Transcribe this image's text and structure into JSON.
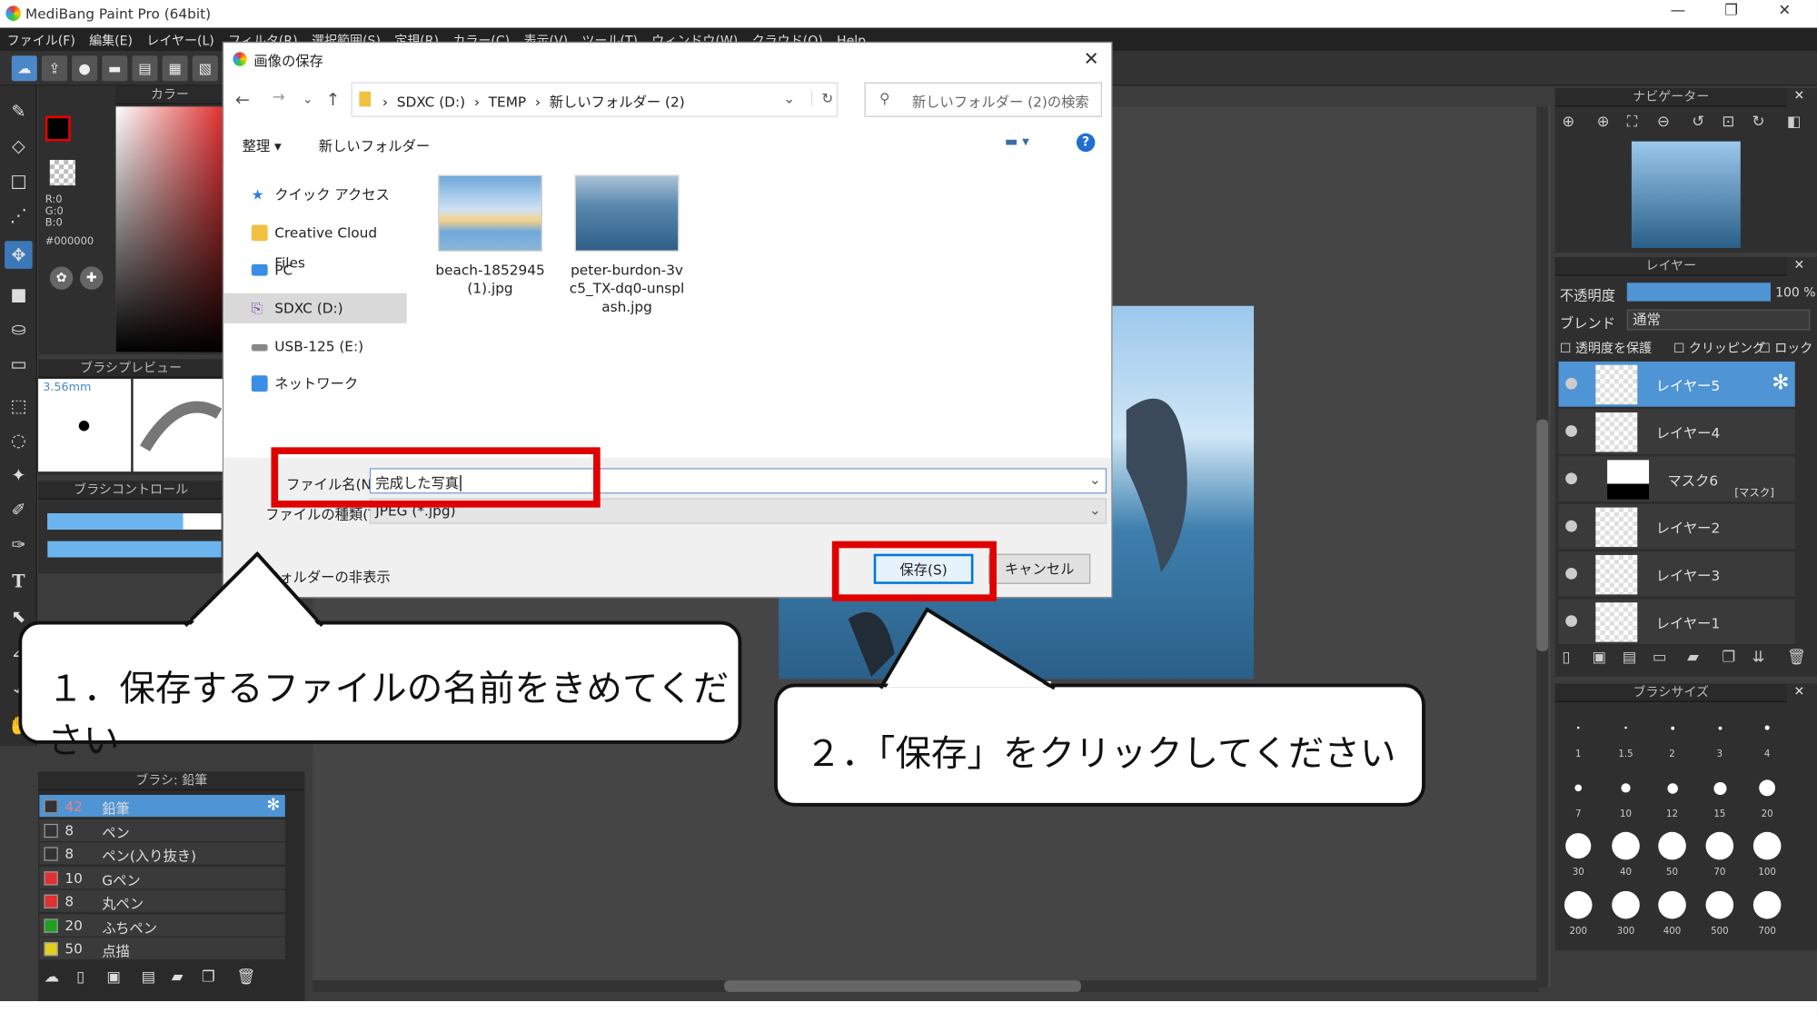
{
  "window": {
    "title": "MediBang Paint Pro (64bit)",
    "controls": [
      "—",
      "❐",
      "✕"
    ]
  },
  "menu": [
    "ファイル(F)",
    "編集(E)",
    "レイヤー(L)",
    "フィルタ(R)",
    "選択範囲(S)",
    "定規(R)",
    "カラー(C)",
    "表示(V)",
    "ツール(T)",
    "ウィンドウ(W)",
    "クラウド(O)",
    "Help"
  ],
  "panels": {
    "color": "カラー",
    "rgb": [
      "R:0",
      "G:0",
      "B:0"
    ],
    "hex": "#000000",
    "brush_preview": "ブラシプレビュー",
    "brush_size": "3.56mm",
    "brush_control": "ブラシコントロール",
    "brush_list_title": "ブラシ: 鉛筆",
    "navigator": "ナビゲーター",
    "layer": "レイヤー",
    "opacity_label": "不透明度",
    "opacity_value": "100 %",
    "blend_label": "ブレンド",
    "blend_value": "通常",
    "protect_alpha": "透明度を保護",
    "clipping": "クリッピング",
    "lock": "ロック",
    "brush_size_panel": "ブラシサイズ"
  },
  "layers": [
    {
      "name": "レイヤー5",
      "selected": true
    },
    {
      "name": "レイヤー4",
      "selected": false
    },
    {
      "name": "マスク6",
      "tag": "[マスク]",
      "selected": false
    },
    {
      "name": "レイヤー2",
      "selected": false
    },
    {
      "name": "レイヤー3",
      "selected": false
    },
    {
      "name": "レイヤー1",
      "selected": false
    }
  ],
  "brushes": [
    {
      "size": "42",
      "name": "鉛筆",
      "color": "#333333",
      "selected": true
    },
    {
      "size": "8",
      "name": "ペン",
      "color": "#333333"
    },
    {
      "size": "8",
      "name": "ペン(入り抜き)",
      "color": "#333333"
    },
    {
      "size": "10",
      "name": "Gペン",
      "color": "#e03030"
    },
    {
      "size": "8",
      "name": "丸ペン",
      "color": "#e03030"
    },
    {
      "size": "20",
      "name": "ふちペン",
      "color": "#20a020"
    },
    {
      "size": "50",
      "name": "点描",
      "color": "#e0d020"
    }
  ],
  "brush_sizes": [
    "1",
    "1.5",
    "2",
    "3",
    "4",
    "7",
    "10",
    "12",
    "15",
    "20",
    "30",
    "40",
    "50",
    "70",
    "100",
    "200",
    "300",
    "400",
    "500",
    "700"
  ],
  "dialog": {
    "title": "画像の保存",
    "path": [
      "SDXC (D:)",
      "TEMP",
      "新しいフォルダー (2)"
    ],
    "search_placeholder": "新しいフォルダー (2)の検索",
    "organize": "整理 ▾",
    "new_folder": "新しいフォルダー",
    "help": "?",
    "nav": [
      "クイック アクセス",
      "Creative Cloud Files",
      "PC",
      "SDXC (D:)",
      "USB-125 (E:)",
      "ネットワーク"
    ],
    "files": [
      {
        "name": "beach-1852945\n(1).jpg"
      },
      {
        "name": "peter-burdon-3v\nc5_TX-dq0-unspl\nash.jpg"
      }
    ],
    "filename_label": "ファイル名(N):",
    "filename_value": "完成した写真",
    "filetype_label": "ファイルの種類(T):",
    "filetype_value": "JPEG (*.jpg)",
    "hide_folders": "フォルダーの非表示",
    "save": "保存(S)",
    "cancel": "キャンセル"
  },
  "callouts": {
    "step1": "１．保存するファイルの名前をきめてください",
    "step2": "２．「保存」をクリックしてください"
  },
  "colors": {
    "accent": "#4f94d4",
    "highlight": "#e00000"
  }
}
